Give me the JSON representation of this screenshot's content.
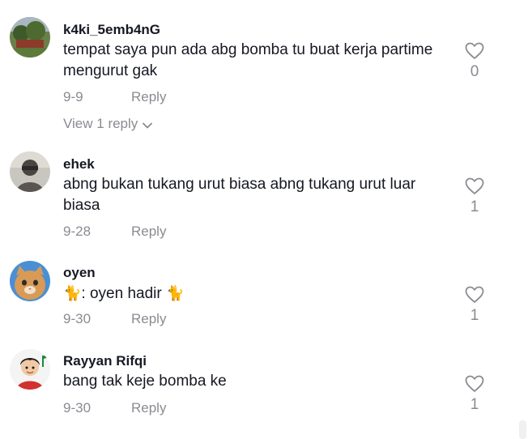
{
  "comments": [
    {
      "username": "k4ki_5emb4nG",
      "text": "tempat saya pun ada abg bomba tu buat kerja partime mengurut gak",
      "date": "9-9",
      "reply_label": "Reply",
      "likes": "0",
      "view_replies": "View 1 reply",
      "avatar": "landscape-photo"
    },
    {
      "username": "ehek",
      "text": "abng bukan tukang urut biasa abng tukang urut luar biasa",
      "date": "9-28",
      "reply_label": "Reply",
      "likes": "1",
      "avatar": "person-photo"
    },
    {
      "username": "oyen",
      "text_emoji": "🐈",
      "text_main": ": oyen hadir ",
      "date": "9-30",
      "reply_label": "Reply",
      "likes": "1",
      "avatar": "orange-cat-photo"
    },
    {
      "username": "Rayyan Rifqi",
      "text": "bang tak keje bomba ke",
      "date": "9-30",
      "reply_label": "Reply",
      "likes": "1",
      "avatar": "cartoon-boy"
    }
  ],
  "icons": {
    "like": "heart-outline-icon",
    "expand": "chevron-down-icon"
  },
  "colors": {
    "text": "#161823",
    "muted": "#8a8b91"
  }
}
